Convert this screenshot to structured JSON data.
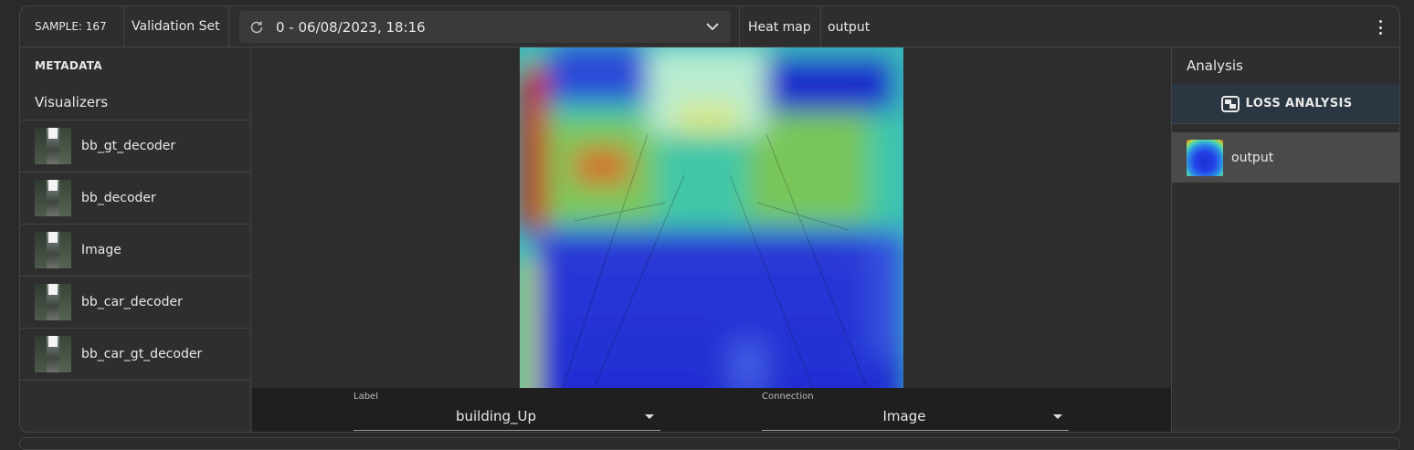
{
  "topbar": {
    "sample": "SAMPLE: 167",
    "dataset": "Validation Set",
    "session": "0 - 06/08/2023, 18:16",
    "refresh_icon": "refresh-icon",
    "dropdown_icon": "chevron-down-icon",
    "view_mode": "Heat map",
    "view_target": "output",
    "menu_icon": "kebab-menu-icon"
  },
  "left": {
    "metadata_heading": "METADATA",
    "visualizers_heading": "Visualizers",
    "items": [
      {
        "label": "bb_gt_decoder"
      },
      {
        "label": "bb_decoder"
      },
      {
        "label": "Image"
      },
      {
        "label": "bb_car_decoder"
      },
      {
        "label": "bb_car_gt_decoder"
      }
    ]
  },
  "controls": {
    "label_caption": "Label",
    "label_value": "building_Up",
    "connection_caption": "Connection",
    "connection_value": "Image"
  },
  "right": {
    "heading": "Analysis",
    "loss_button": "LOSS ANALYSIS",
    "output_item": "output"
  },
  "colors": {
    "background": "#2e2e2e",
    "border": "#444444",
    "loss_button_bg": "#2a3641",
    "selected_item_bg": "#4a4a4a",
    "control_bar_bg": "#1f1f1f"
  }
}
